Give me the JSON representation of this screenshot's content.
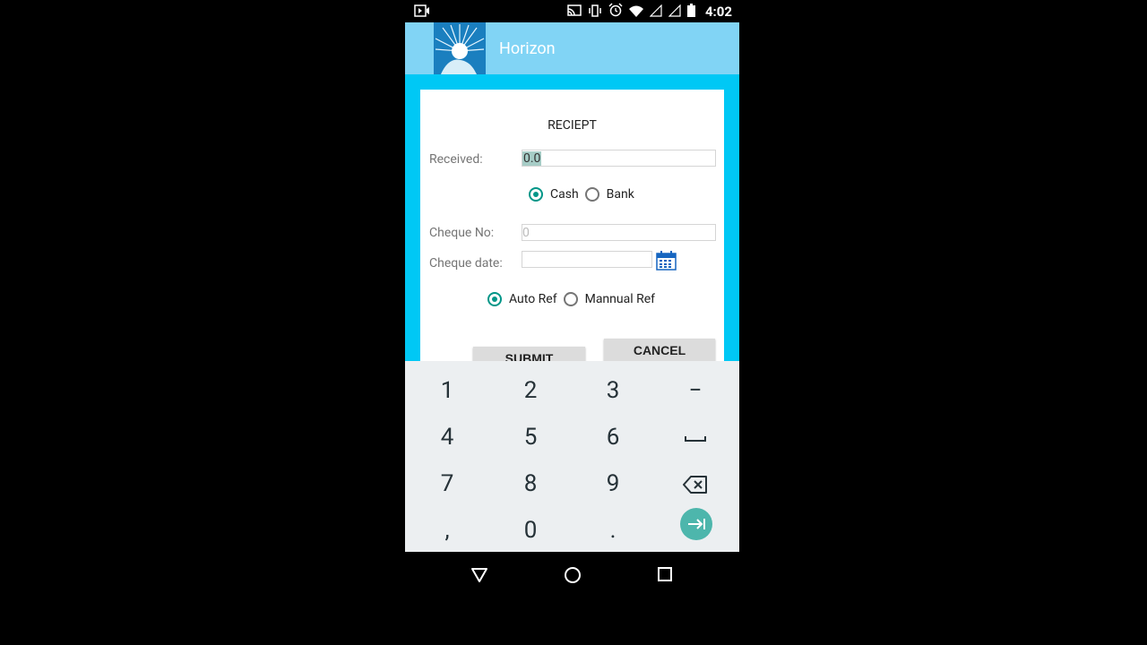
{
  "status": {
    "time": "4:02"
  },
  "app": {
    "title": "Horizon"
  },
  "form": {
    "title": "RECIEPT",
    "received_label": "Received:",
    "received_value": "0.0",
    "payment_options": [
      {
        "label": "Cash",
        "selected": true
      },
      {
        "label": "Bank",
        "selected": false
      }
    ],
    "cheque_no_label": "Cheque No:",
    "cheque_no_placeholder": "0",
    "cheque_date_label": "Cheque date:",
    "cheque_date_value": "",
    "ref_options": [
      {
        "label": "Auto Ref",
        "selected": true
      },
      {
        "label": "Mannual Ref",
        "selected": false
      }
    ],
    "submit_label": "SUBMIT",
    "cancel_label": "CANCEL"
  },
  "keyboard": {
    "rows": [
      [
        "1",
        "2",
        "3",
        "−"
      ],
      [
        "4",
        "5",
        "6",
        "space"
      ],
      [
        "7",
        "8",
        "9",
        "backspace"
      ],
      [
        ",",
        "0",
        ".",
        "next"
      ]
    ]
  },
  "colors": {
    "appbar": "#81d4f5",
    "form_bg": "#00c8f5",
    "accent": "#009688",
    "enter_key": "#4db6ac"
  }
}
